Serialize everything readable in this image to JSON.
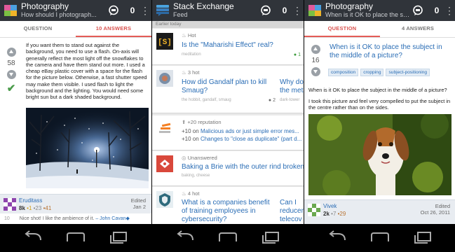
{
  "screen1": {
    "title": "Photography",
    "subtitle": "How should I photograph...",
    "count": "0",
    "tabs": [
      "QUESTION",
      "10 ANSWERS"
    ],
    "votes": "58",
    "body": "If you want them to stand out against the background, you need to use a flash. On-axis will generally reflect the most light off the snowflakes to the camera and have them stand out more. I used a cheap eBay plastic cover with a space for the flash for the picture below. Otherwise, a fast shutter speed may make them visible. I used flash to light the background and the lighting. You would need some bright sun but a dark shaded background.",
    "user": {
      "name": "Eruditass",
      "rep": "8k",
      "gold": "•1",
      "silver": "•23",
      "bronze": "•41"
    },
    "edited": "Edited",
    "edited_date": "Jan 2",
    "comment": {
      "num": "10",
      "text": "Nice shot! I like the ambience of it.",
      "author": "– John Cavan◆"
    }
  },
  "screen2": {
    "title": "Stack Exchange",
    "subtitle": "Feed",
    "count": "0",
    "section": "Earlier today",
    "cards": [
      {
        "tag": "Hot",
        "title": "Is the \"Maharishi Effect\" real?",
        "site": "meditation",
        "badge": "1"
      },
      {
        "tag": "3 hot",
        "title": "How did Gandalf plan to kill Smaug?",
        "site": "the hobbit, gandalf, smaug",
        "badge": "2",
        "right_title": "Why do",
        "right_title2": "the meta",
        "right_site": "dark-tower"
      },
      {
        "tag": "+20 reputation",
        "line1_prefix": "+10 on",
        "line1": "Malicious ads or just simple error mes...",
        "line2_prefix": "+10 on",
        "line2": "Changes to \"close as duplicate\" (part d..."
      },
      {
        "tag": "Unanswered",
        "title": "Baking a Brie with the outer rind broken",
        "site": "baking, cheese"
      },
      {
        "tag": "4 hot",
        "title": "What is a companies benefit of training employees in cybersecurity?",
        "right_title": "Can I",
        "right_title2": "reducer",
        "right_title3": "telecov"
      }
    ]
  },
  "screen3": {
    "title": "Photography",
    "subtitle": "When is it OK to place the subject in the...",
    "count": "0",
    "tabs": [
      "QUESTION",
      "4 ANSWERS"
    ],
    "votes": "16",
    "q_title": "When is it OK to place the subject in the middle of a picture?",
    "tags": [
      "composition",
      "cropping",
      "subject-positioning"
    ],
    "body1": "When is it OK to place the subject in the middle of a picture?",
    "body2": "I took this picture and feel very compelled to put the subject in the centre rather than on the sides.",
    "user": {
      "name": "Vivek",
      "rep": "2k",
      "silver": "•7",
      "bronze": "•29"
    },
    "edited": "Edited",
    "edited_date": "Oct 26, 2011"
  },
  "icons": [
    "back-icon",
    "home-icon",
    "recent-apps-icon",
    "inbox-icon",
    "overflow-menu-icon"
  ],
  "colors": {
    "accent": "#e45b56",
    "link": "#2a6db5",
    "topbar": "#30343a"
  }
}
